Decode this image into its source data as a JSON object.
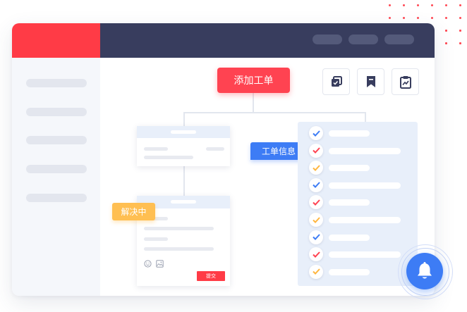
{
  "toolbar": {
    "add_ticket_label": "添加工单"
  },
  "tags": {
    "ticket_info": "工单信息",
    "resolving": "解决中"
  },
  "card": {
    "submit_label": "提交"
  },
  "colors": {
    "brand_red": "#ff3b46",
    "topbar_dark": "#383d5e",
    "accent_blue": "#3d7cf5",
    "accent_orange": "#ffb640"
  },
  "checklist": {
    "items": [
      {
        "icon": "check-icon",
        "color": "#3d7cf5"
      },
      {
        "icon": "check-icon",
        "color": "#ff4351"
      },
      {
        "icon": "check-icon",
        "color": "#ffb640"
      },
      {
        "icon": "check-icon",
        "color": "#3d7cf5"
      },
      {
        "icon": "check-icon",
        "color": "#ff4351"
      },
      {
        "icon": "check-icon",
        "color": "#ffb640"
      },
      {
        "icon": "check-icon",
        "color": "#3d7cf5"
      },
      {
        "icon": "check-icon",
        "color": "#ff4351"
      },
      {
        "icon": "check-icon",
        "color": "#ffb640"
      }
    ]
  }
}
